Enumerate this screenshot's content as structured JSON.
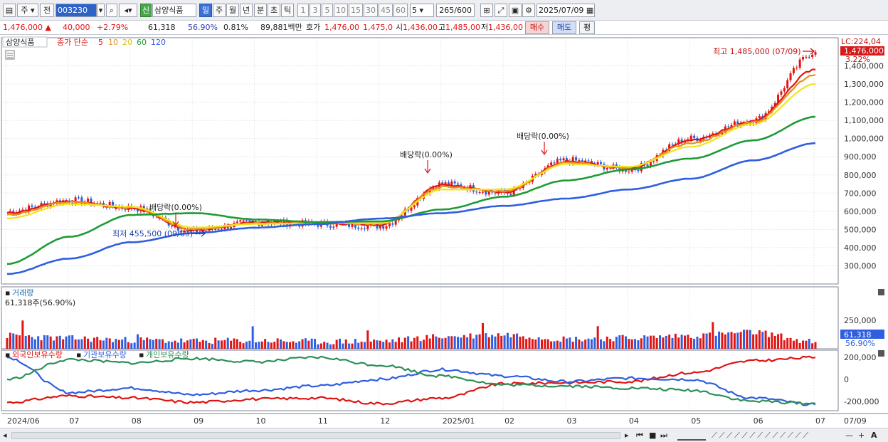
{
  "toolbar": {
    "market": "주",
    "prev": "전",
    "code": "003230",
    "stock_name": "삼양식품",
    "badge_new": "신",
    "periods": [
      "일",
      "주",
      "월",
      "년",
      "분",
      "초",
      "틱"
    ],
    "intervals": [
      "1",
      "3",
      "5",
      "10",
      "15",
      "30",
      "45",
      "60"
    ],
    "step": "5",
    "count": "265",
    "count_max": "/600",
    "date": "2025/07/09"
  },
  "info": {
    "price": "1,476,000",
    "change": "40,000",
    "change_pct": "+2.79%",
    "volume": "61,318",
    "volume_ratio": "56.90%",
    "turnover": "0.81%",
    "amount": "89,881백만",
    "quote_label": "호가",
    "ask": "1,476,00",
    "bid": "1,475,0",
    "open_label": "시",
    "open": "1,436,00",
    "high_label": "고",
    "high": "1,485,00",
    "low_label": "저",
    "low": "1,436,00",
    "buy_btn": "매수",
    "sell_btn": "매도",
    "eval_btn": "평"
  },
  "price_panel": {
    "legend_name": "삼양식품",
    "legend_series": "종가 단순",
    "ma_labels": [
      "5",
      "10",
      "20",
      "60",
      "120"
    ],
    "ma_colors": [
      "#e11414",
      "#e8901a",
      "#f2e41a",
      "#1f9b36",
      "#2f5fe0"
    ],
    "lc_label": "LC:224,04",
    "last_price_label": "1,476,000",
    "last_pct_label": "3.22%",
    "high_note": "최고 1,485,000 (07/09)",
    "low_note": "최저 455,500 (09/09)",
    "dividend_note": "배당락(0.00%)",
    "y_ticks": [
      "1,400,000",
      "1,300,000",
      "1,200,000",
      "1,100,000",
      "1,000,000",
      "900,000",
      "800,000",
      "700,000",
      "600,000",
      "500,000",
      "400,000",
      "300,000"
    ]
  },
  "volume_panel": {
    "title": "거래량",
    "value_label": "61,318주(56.90%)",
    "y_tick": "250,000",
    "last_label": "61,318",
    "last_pct": "56.90%"
  },
  "holding_panel": {
    "series_labels": [
      "외국인보유수량",
      "기관보유수량",
      "개인보유수량"
    ],
    "series_colors": [
      "#e11414",
      "#2f5fe0",
      "#2e8f57"
    ],
    "y_ticks": [
      "200,000",
      "0",
      "-200,000"
    ]
  },
  "x_labels": [
    "2024/06",
    "07",
    "08",
    "09",
    "10",
    "11",
    "12",
    "2025/01",
    "02",
    "03",
    "04",
    "05",
    "06",
    "07"
  ],
  "x_right_label": "07/09",
  "chart_data": {
    "type": "line",
    "title": "삼양식품 (003230) 일봉",
    "x": [
      "2024/06",
      "07",
      "08",
      "09",
      "10",
      "11",
      "12",
      "2025/01",
      "02",
      "03",
      "04",
      "05",
      "06",
      "07"
    ],
    "series": [
      {
        "name": "종가",
        "values": [
          600000,
          660000,
          620000,
          490000,
          540000,
          530000,
          520000,
          750000,
          700000,
          880000,
          830000,
          1000000,
          1100000,
          1476000
        ]
      },
      {
        "name": "5",
        "values": [
          590000,
          655000,
          615000,
          495000,
          540000,
          535000,
          525000,
          745000,
          705000,
          875000,
          835000,
          990000,
          1095000,
          1380000
        ]
      },
      {
        "name": "10",
        "values": [
          580000,
          650000,
          620000,
          500000,
          535000,
          535000,
          530000,
          735000,
          710000,
          870000,
          840000,
          975000,
          1090000,
          1350000
        ]
      },
      {
        "name": "20",
        "values": [
          560000,
          640000,
          625000,
          510000,
          530000,
          535000,
          535000,
          720000,
          720000,
          860000,
          845000,
          955000,
          1080000,
          1300000
        ]
      },
      {
        "name": "60",
        "values": [
          310000,
          460000,
          580000,
          590000,
          555000,
          540000,
          545000,
          610000,
          680000,
          770000,
          830000,
          890000,
          990000,
          1120000
        ]
      },
      {
        "name": "120",
        "values": [
          255000,
          340000,
          430000,
          480000,
          510000,
          530000,
          560000,
          590000,
          630000,
          670000,
          720000,
          780000,
          880000,
          975000
        ]
      }
    ],
    "volume": [
      120000,
      95000,
      80000,
      70000,
      75000,
      65000,
      70000,
      110000,
      130000,
      90000,
      100000,
      120000,
      150000,
      61318
    ],
    "holdings": {
      "x": [
        "2024/06",
        "07",
        "08",
        "09",
        "10",
        "11",
        "12",
        "2025/01",
        "02",
        "03",
        "04",
        "05",
        "06",
        "07"
      ],
      "외국인보유수량": [
        -210000,
        -150000,
        -170000,
        -210000,
        -180000,
        -170000,
        -220000,
        -170000,
        -40000,
        -30000,
        -20000,
        60000,
        170000,
        200000
      ],
      "기관보유수량": [
        200000,
        -120000,
        -80000,
        -140000,
        -100000,
        -60000,
        0,
        90000,
        30000,
        -20000,
        10000,
        0,
        -170000,
        -230000
      ],
      "개인보유수량": [
        0,
        180000,
        150000,
        190000,
        160000,
        200000,
        130000,
        30000,
        -50000,
        -60000,
        -80000,
        -100000,
        -200000,
        -220000
      ]
    },
    "ylim": [
      200000,
      1500000
    ],
    "grid": true,
    "legend": "top-left"
  }
}
